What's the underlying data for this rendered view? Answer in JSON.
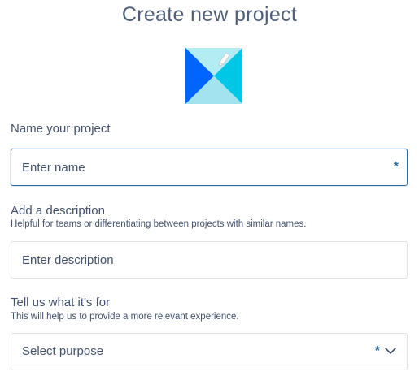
{
  "header": {
    "title": "Create new project"
  },
  "avatar": {
    "icon": "project-avatar-icon",
    "edit_icon": "pencil-icon",
    "colors": {
      "dark_blue": "#0065ff",
      "teal": "#00c7e6",
      "light_cyan": "#b3ecf3"
    }
  },
  "name_field": {
    "label": "Name your project",
    "placeholder": "Enter name",
    "value": "",
    "required_mark": "*"
  },
  "description_field": {
    "label": "Add a description",
    "help": "Helpful for teams or differentiating between projects with similar names.",
    "placeholder": "Enter description",
    "value": ""
  },
  "purpose_field": {
    "label": "Tell us what it's for",
    "help": "This will help us to provide a more relevant experience.",
    "selected": "Select purpose",
    "required_mark": "*",
    "icon": "chevron-down-icon"
  },
  "colors": {
    "focus_border": "#2d6ca2",
    "border": "#dfe1e6",
    "text": "#42526e"
  }
}
